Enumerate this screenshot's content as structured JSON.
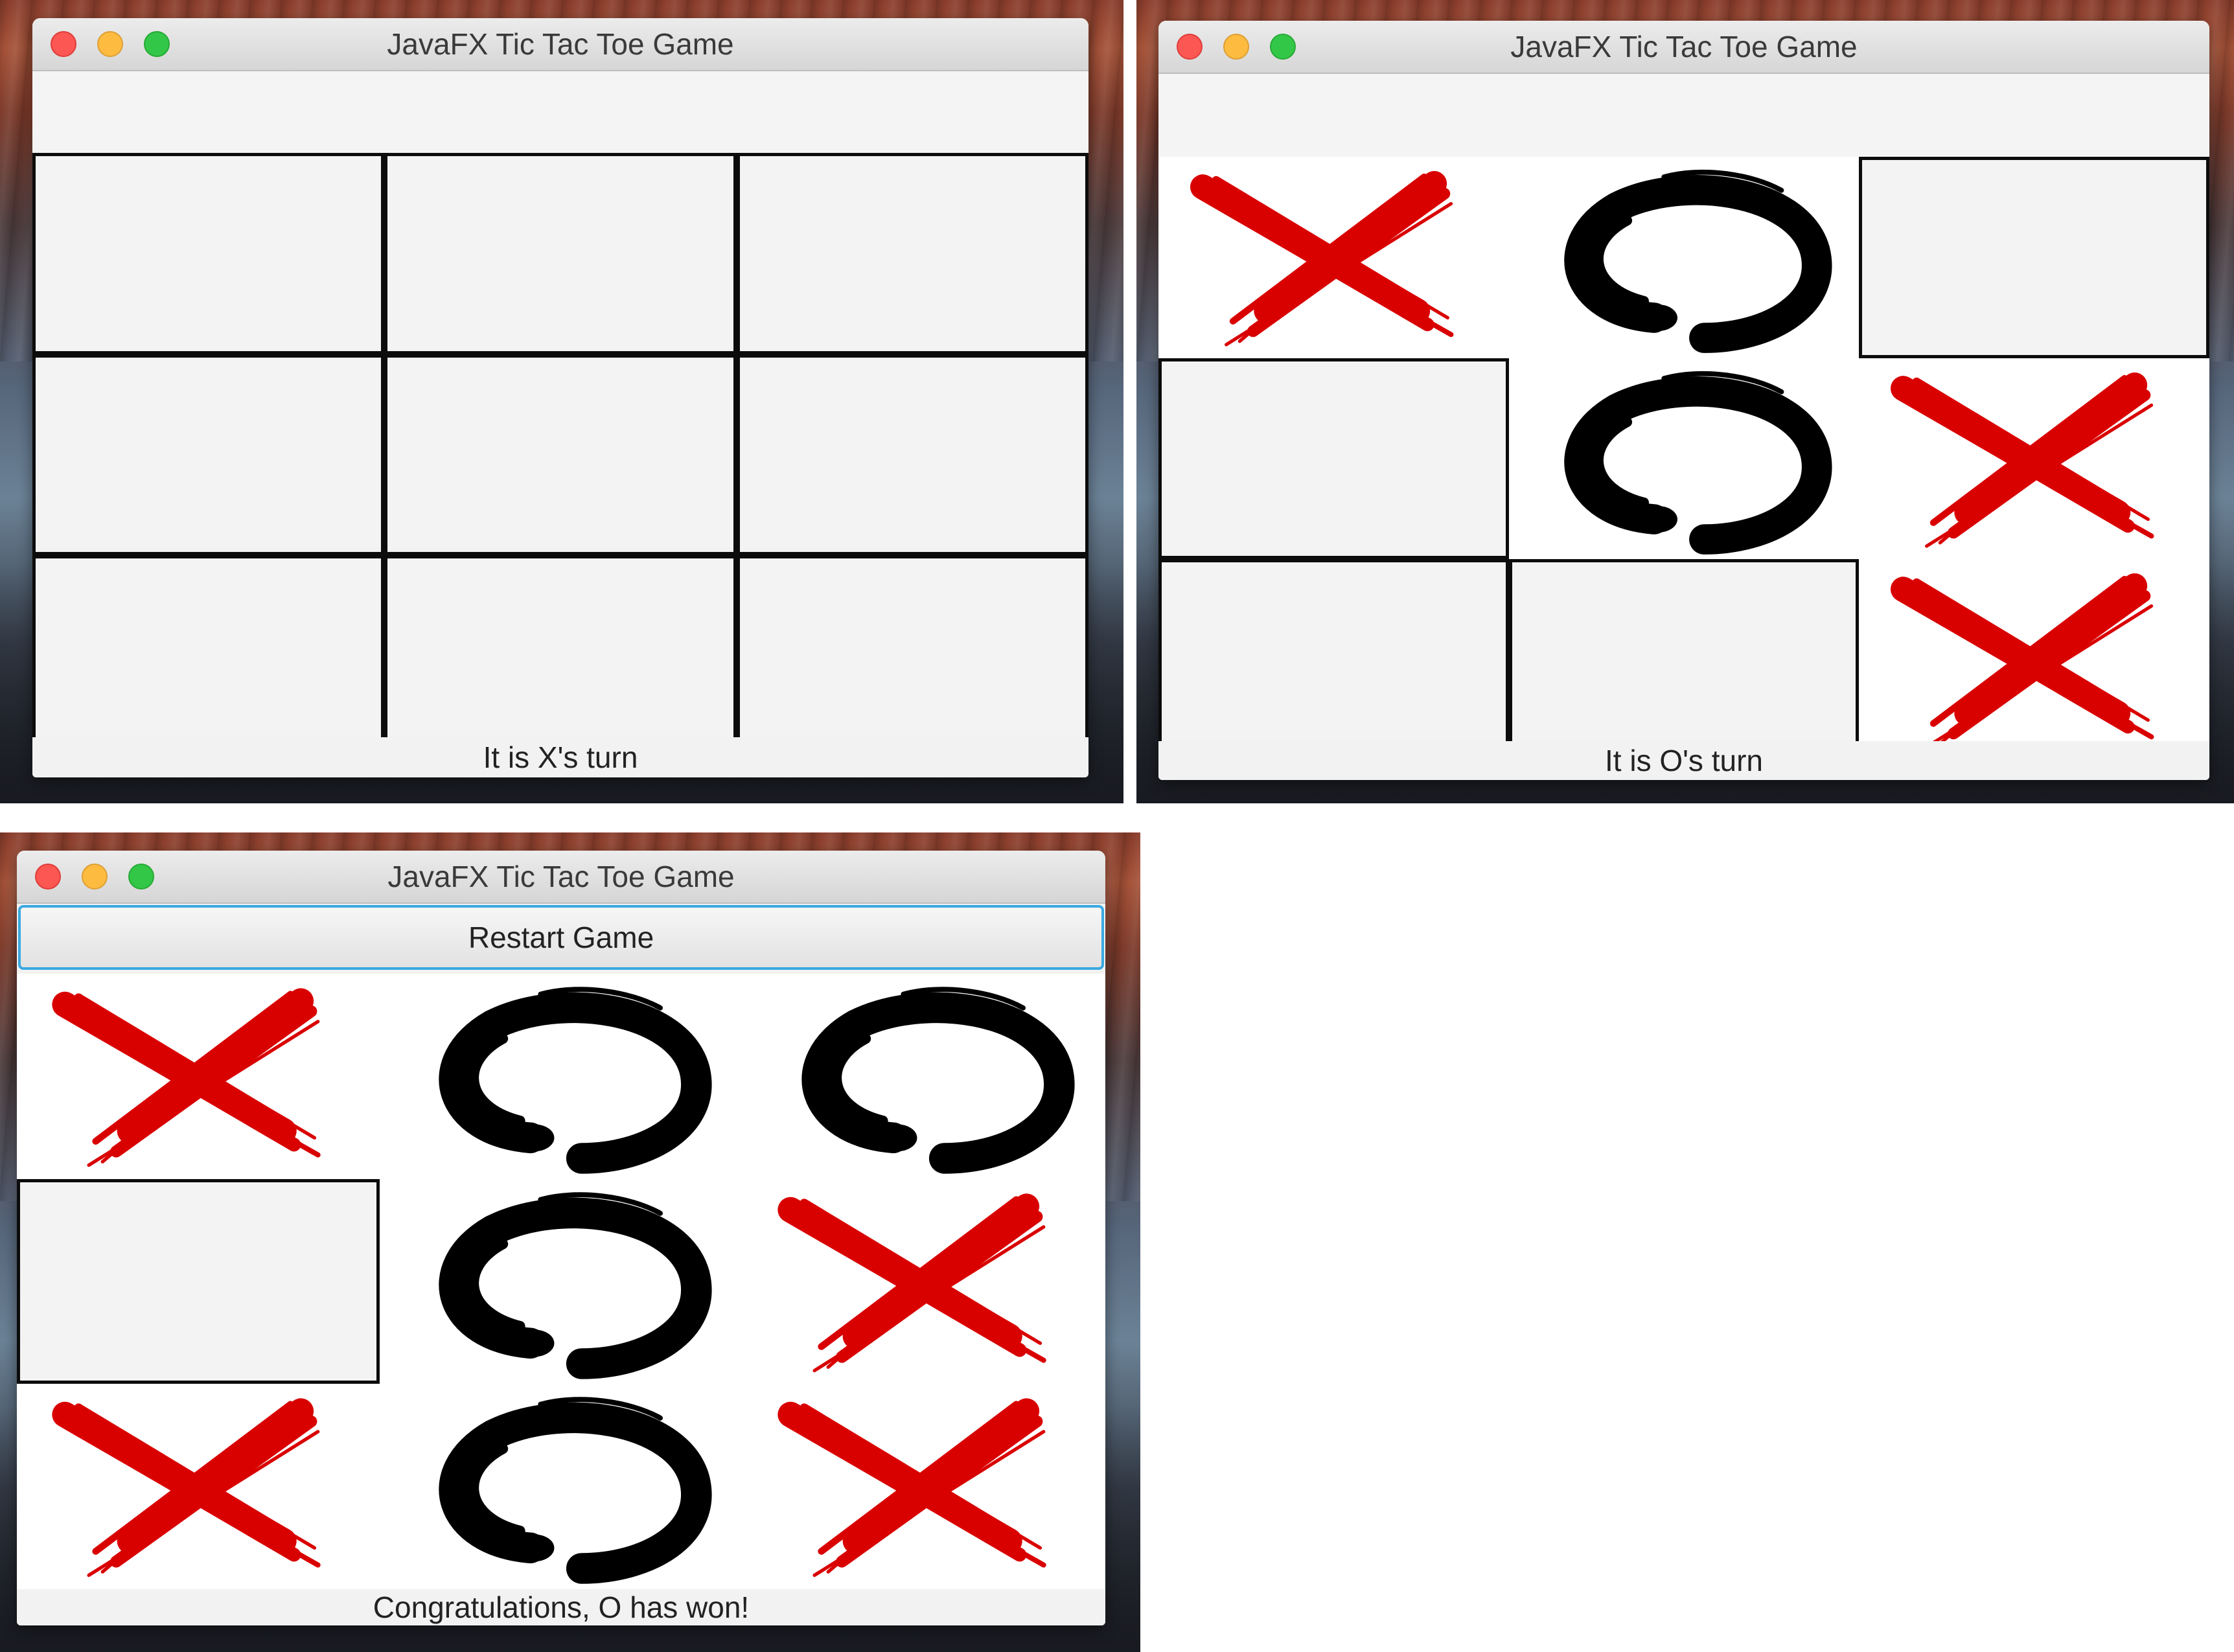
{
  "colors": {
    "x_mark": "#d90000",
    "o_mark": "#000000",
    "empty_cell": "#f3f3f3",
    "focus_ring": "#3aa9e0"
  },
  "icons": {
    "x": "brush-x-icon",
    "o": "brush-o-icon"
  },
  "windows": [
    {
      "title": "JavaFX Tic Tac Toe Game",
      "status": "It is X's turn",
      "board": [
        "",
        "",
        "",
        "",
        "",
        "",
        "",
        "",
        ""
      ]
    },
    {
      "title": "JavaFX Tic Tac Toe Game",
      "status": "It is O's turn",
      "board": [
        "X",
        "O",
        "",
        "",
        "O",
        "X",
        "",
        "",
        "X"
      ]
    },
    {
      "title": "JavaFX Tic Tac Toe Game",
      "restart_label": "Restart Game",
      "status": "Congratulations, O has won!",
      "board": [
        "X",
        "O",
        "O",
        "",
        "O",
        "X",
        "X",
        "O",
        "X"
      ]
    }
  ]
}
